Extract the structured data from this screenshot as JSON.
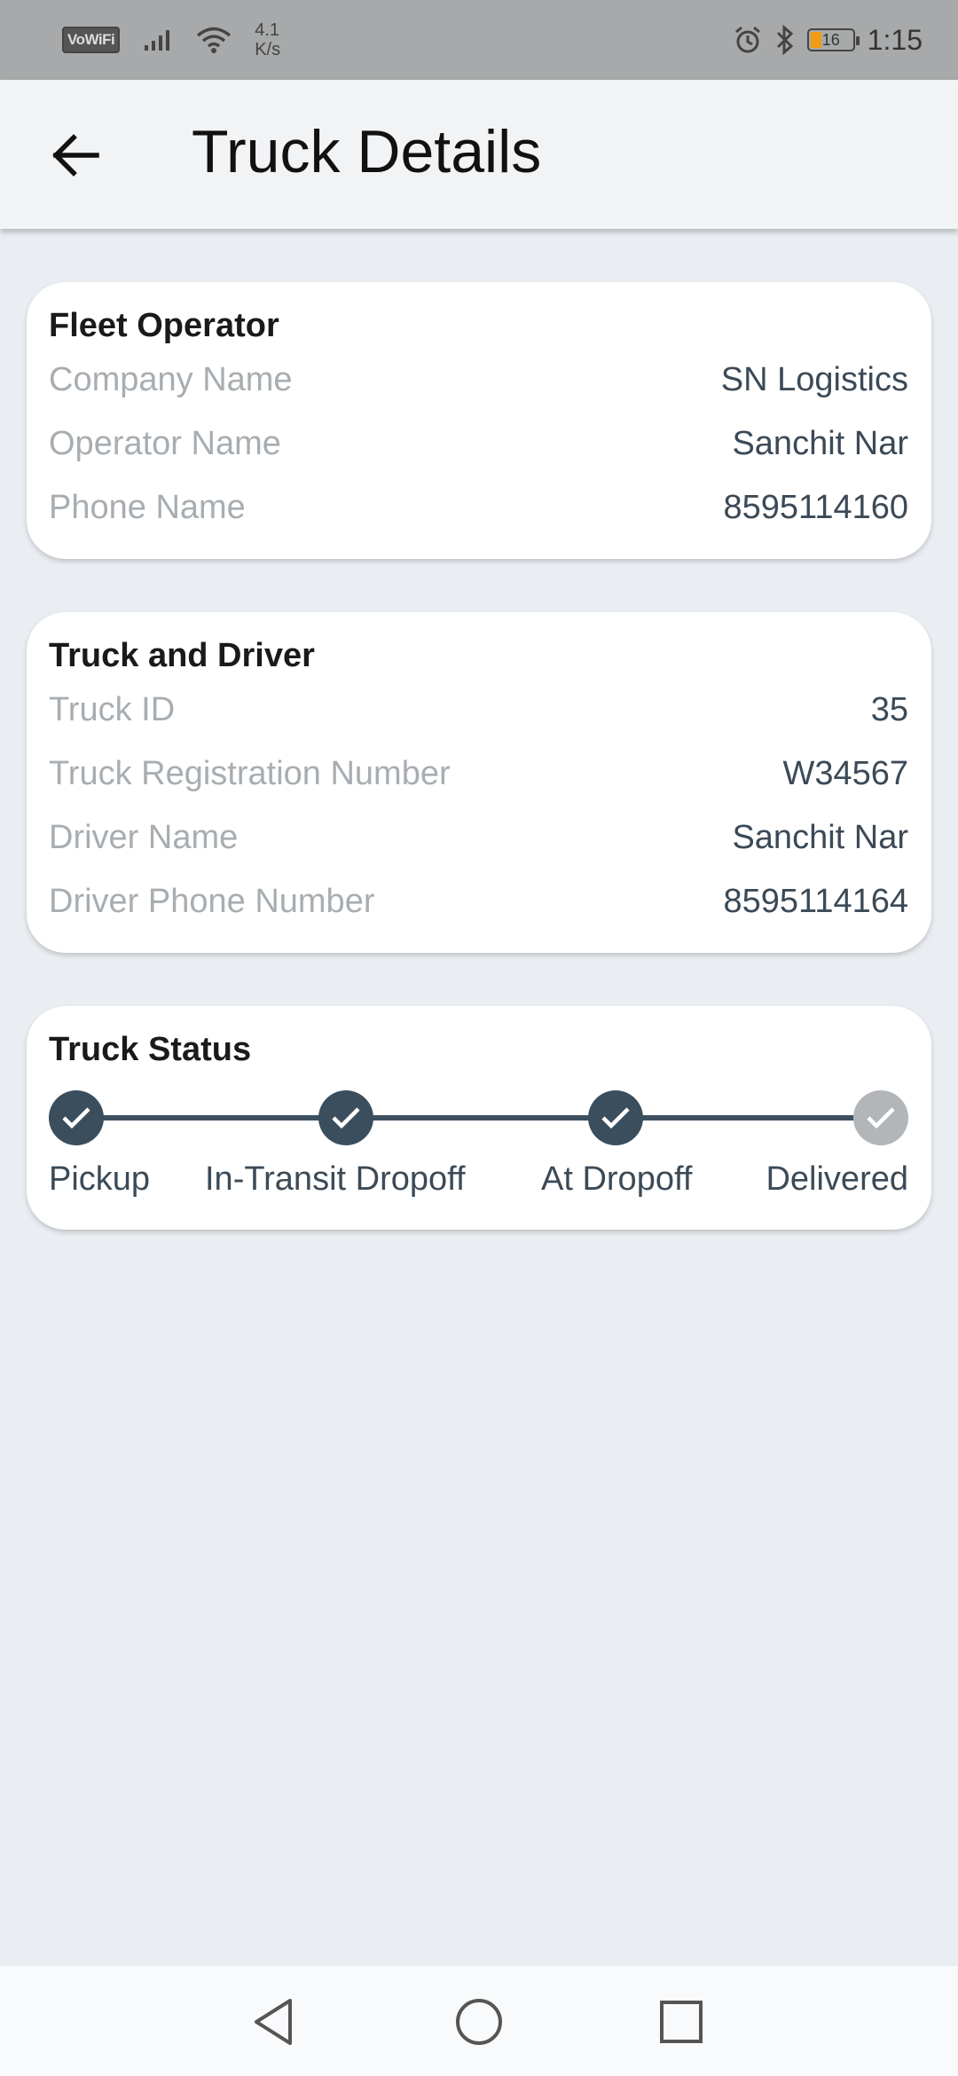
{
  "status_bar": {
    "vowifi": "VoWiFi",
    "speed_value": "4.1",
    "speed_unit": "K/s",
    "battery_level": "16",
    "time": "1:15",
    "icons": [
      "signal-icon",
      "wifi-icon",
      "alarm-icon",
      "bluetooth-icon",
      "battery-icon"
    ]
  },
  "app_bar": {
    "title": "Truck Details",
    "back_icon": "arrow-left-icon"
  },
  "fleet_operator": {
    "heading": "Fleet Operator",
    "rows": [
      {
        "label": "Company Name",
        "value": "SN Logistics"
      },
      {
        "label": "Operator Name",
        "value": "Sanchit Nar"
      },
      {
        "label": "Phone Name",
        "value": "8595114160"
      }
    ]
  },
  "truck_driver": {
    "heading": "Truck and Driver",
    "rows": [
      {
        "label": "Truck ID",
        "value": "35"
      },
      {
        "label": "Truck Registration Number",
        "value": "W34567"
      },
      {
        "label": "Driver Name",
        "value": "Sanchit Nar"
      },
      {
        "label": "Driver Phone Number",
        "value": "8595114164"
      }
    ]
  },
  "truck_status": {
    "heading": "Truck Status",
    "steps": [
      {
        "label": "Pickup",
        "completed": true
      },
      {
        "label": "In-Transit Dropoff",
        "completed": true
      },
      {
        "label": "At Dropoff",
        "completed": true
      },
      {
        "label": "Delivered",
        "completed": false
      }
    ],
    "colors": {
      "done": "#3b4e5d",
      "pending": "#b3b6b9"
    }
  },
  "nav_bar": {
    "icons": [
      "back-triangle-icon",
      "home-circle-icon",
      "recents-square-icon"
    ]
  }
}
